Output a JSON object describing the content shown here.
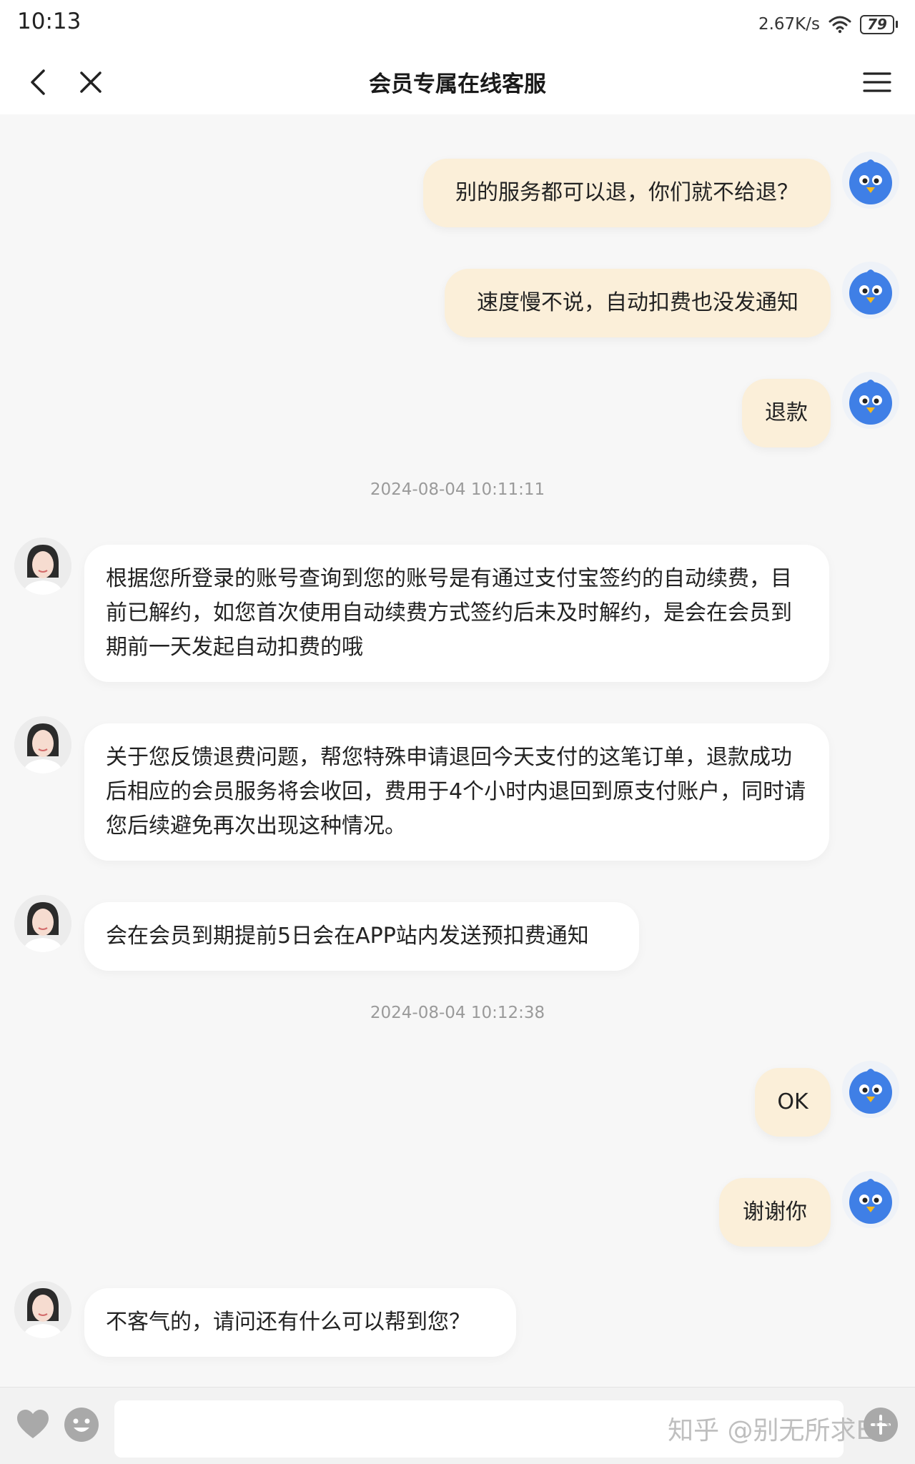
{
  "status_bar": {
    "time": "10:13",
    "net_speed": "2.67K/s",
    "battery": "79",
    "icons": [
      "wifi-icon",
      "battery-icon"
    ]
  },
  "nav": {
    "title": "会员专属在线客服",
    "icons": [
      "back-icon",
      "close-icon",
      "menu-icon"
    ]
  },
  "messages": [
    {
      "role": "user",
      "text": "别的服务都可以退，你们就不给退？"
    },
    {
      "role": "user",
      "text": "速度慢不说，自动扣费也没发通知"
    },
    {
      "role": "user",
      "text": "退款"
    },
    {
      "role": "time",
      "text": "2024-08-04 10:11:11"
    },
    {
      "role": "agent",
      "text": "根据您所登录的账号查询到您的账号是有通过支付宝签约的自动续费，目前已解约，如您首次使用自动续费方式签约后未及时解约，是会在会员到期前一天发起自动扣费的哦"
    },
    {
      "role": "agent",
      "text": "关于您反馈退费问题，帮您特殊申请退回今天支付的这笔订单，退款成功后相应的会员服务将会收回，费用于4个小时内退回到原支付账户，同时请您后续避免再次出现这种情况。"
    },
    {
      "role": "agent",
      "text": "会在会员到期提前5日会在APP站内发送预扣费通知"
    },
    {
      "role": "time",
      "text": "2024-08-04 10:12:38"
    },
    {
      "role": "user",
      "text": "OK"
    },
    {
      "role": "user",
      "text": "谢谢你"
    },
    {
      "role": "agent",
      "text": "不客气的，请问还有什么可以帮到您？"
    }
  ],
  "input_bar": {
    "value": "",
    "icons": [
      "heart-icon",
      "emoji-icon",
      "plus-icon"
    ]
  },
  "watermark": "知乎 @别无所求ED",
  "colors": {
    "user_bubble": "#fbefd9",
    "agent_bubble": "#ffffff",
    "background": "#f7f7f7",
    "user_avatar": "#3f7fe6"
  }
}
